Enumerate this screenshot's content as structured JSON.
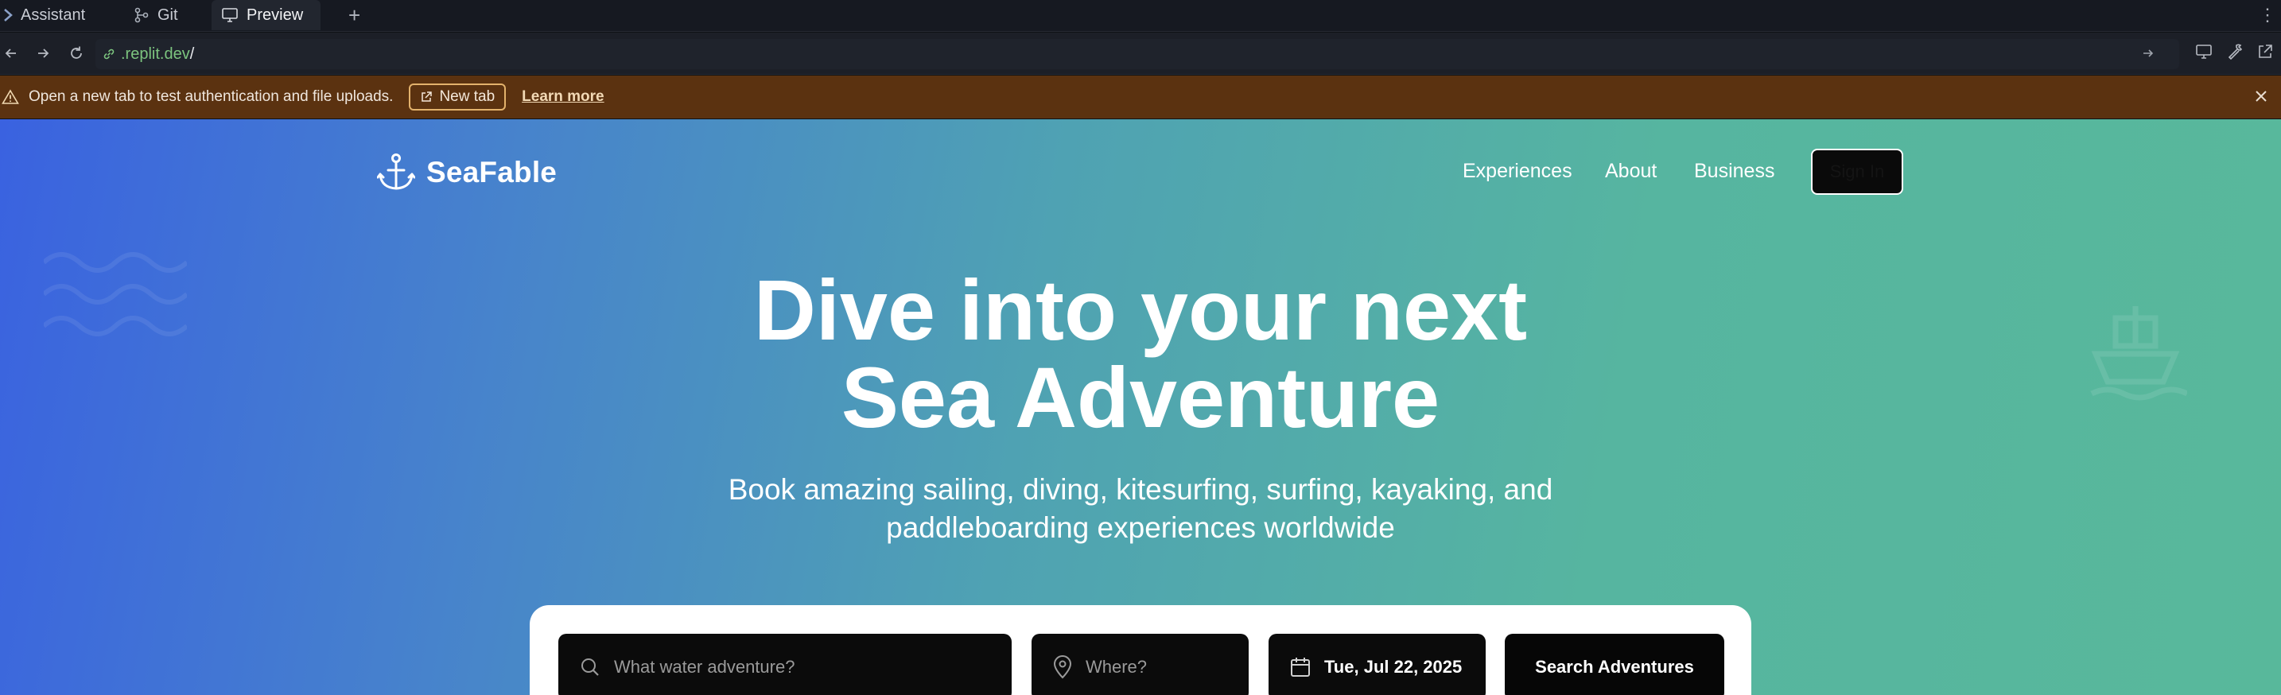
{
  "tabs": [
    {
      "label": "Assistant",
      "icon": "assistant-icon"
    },
    {
      "label": "Git",
      "icon": "git-branch-icon"
    },
    {
      "label": "Preview",
      "icon": "monitor-icon",
      "active": true
    }
  ],
  "address": {
    "url_host": ".replit.dev",
    "url_path": "/"
  },
  "banner": {
    "message": "Open a new tab to test authentication and file uploads.",
    "new_tab_label": "New tab",
    "learn_more_label": "Learn more"
  },
  "site": {
    "brand": "SeaFable",
    "nav": [
      "Experiences",
      "About",
      "Business"
    ],
    "sign_in_label": "Sign In",
    "headline_line1": "Dive into your next",
    "headline_line2": "Sea Adventure",
    "subhead_line1": "Book amazing sailing, diving, kitesurfing, surfing, kayaking, and",
    "subhead_line2": "paddleboarding experiences worldwide",
    "search": {
      "activity_placeholder": "What water adventure?",
      "location_placeholder": "Where?",
      "date_value": "Tue, Jul 22, 2025",
      "button_label": "Search Adventures"
    }
  },
  "colors": {
    "banner_bg": "#5b3210",
    "hero_gradient_start": "#3a62e0",
    "hero_gradient_end": "#58b89b"
  }
}
